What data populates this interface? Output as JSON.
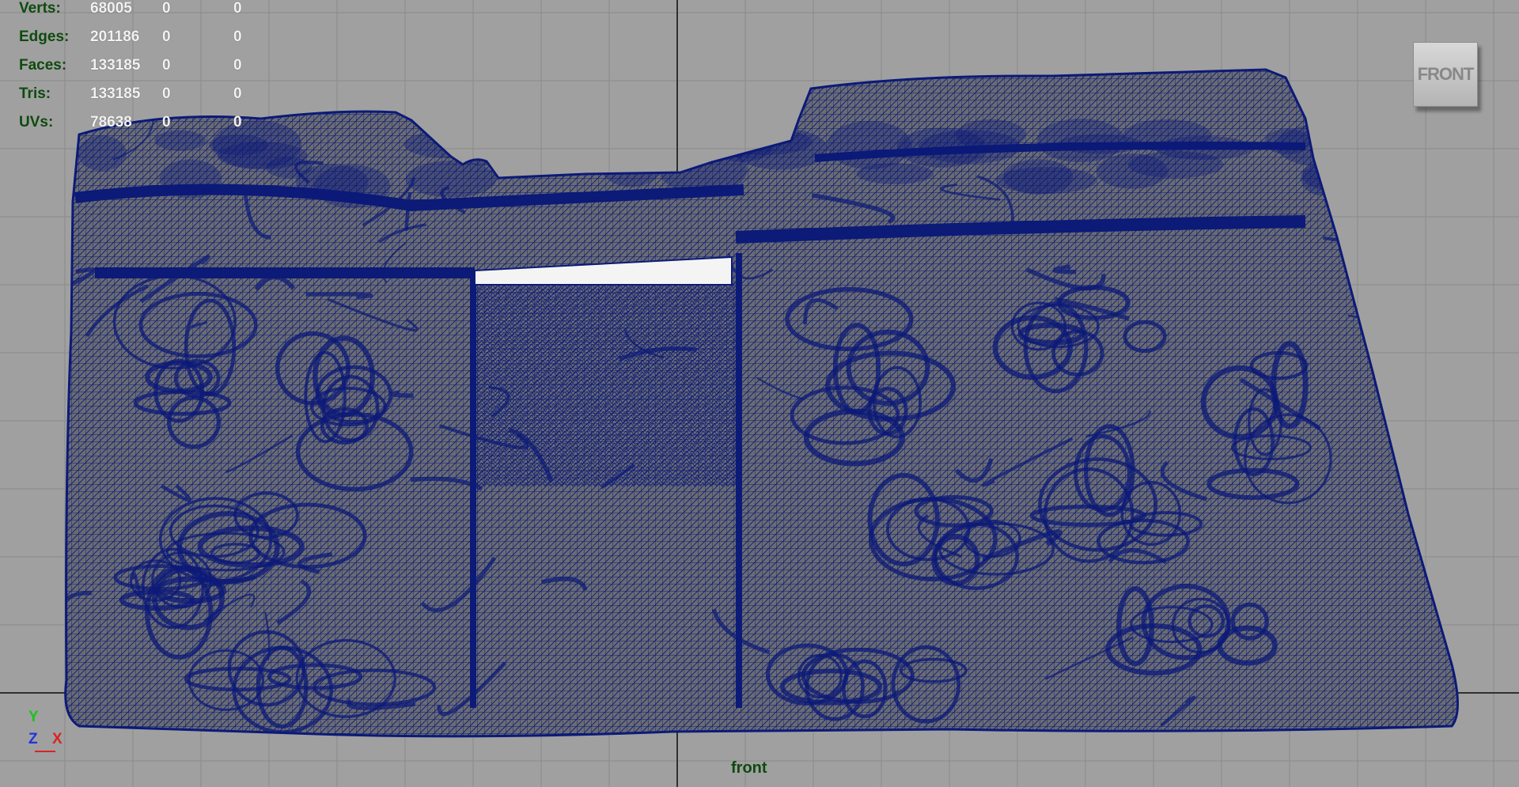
{
  "hud": {
    "rows": [
      {
        "label": "Verts:",
        "v1": "68005",
        "v2": "0",
        "v3": "0"
      },
      {
        "label": "Edges:",
        "v1": "201186",
        "v2": "0",
        "v3": "0"
      },
      {
        "label": "Faces:",
        "v1": "133185",
        "v2": "0",
        "v3": "0"
      },
      {
        "label": "Tris:",
        "v1": "133185",
        "v2": "0",
        "v3": "0"
      },
      {
        "label": "UVs:",
        "v1": "78638",
        "v2": "0",
        "v3": "0"
      }
    ]
  },
  "view_cube": {
    "label": "FRONT"
  },
  "camera_label": "front",
  "axis": {
    "y": "Y",
    "z": "Z",
    "x": "X"
  },
  "colors": {
    "viewport_bg": "#a0a0a0",
    "grid": "#8a8a8a",
    "grid_axis": "#303030",
    "mesh_fill": "#6a6c72",
    "wireframe": "#0c1a78",
    "hud_label": "#0f4a0f",
    "hud_value": "#f2f2f2",
    "axis_y": "#18c418",
    "axis_z": "#2233dd",
    "axis_x": "#dd2222"
  },
  "icons": [
    "view-cube-icon",
    "axis-gizmo-icon"
  ]
}
